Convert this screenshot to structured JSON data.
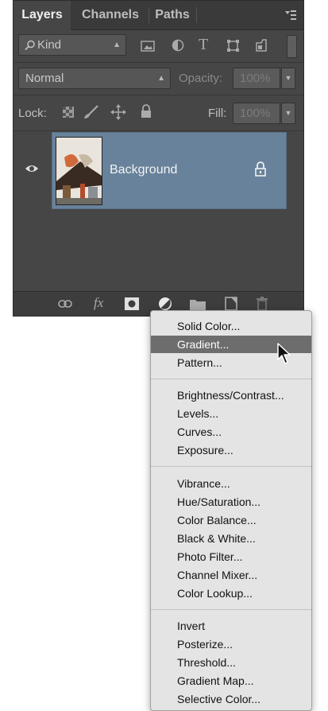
{
  "tabs": [
    {
      "label": "Layers",
      "active": true
    },
    {
      "label": "Channels",
      "active": false
    },
    {
      "label": "Paths",
      "active": false
    }
  ],
  "filter": {
    "kind_label": "Kind"
  },
  "blend": {
    "mode": "Normal",
    "opacity_label": "Opacity:",
    "opacity_value": "100%"
  },
  "lock": {
    "label": "Lock:",
    "fill_label": "Fill:",
    "fill_value": "100%"
  },
  "layer": {
    "name": "Background",
    "visible": true,
    "locked": true
  },
  "menu": {
    "groups": [
      [
        "Solid Color...",
        "Gradient...",
        "Pattern..."
      ],
      [
        "Brightness/Contrast...",
        "Levels...",
        "Curves...",
        "Exposure..."
      ],
      [
        "Vibrance...",
        "Hue/Saturation...",
        "Color Balance...",
        "Black & White...",
        "Photo Filter...",
        "Channel Mixer...",
        "Color Lookup..."
      ],
      [
        "Invert",
        "Posterize...",
        "Threshold...",
        "Gradient Map...",
        "Selective Color..."
      ]
    ],
    "highlighted": "Gradient..."
  },
  "colors": {
    "panel": "#464646",
    "selected_layer": "#68829b",
    "menu_bg": "#e4e4e4",
    "menu_highlight": "#6d6d6d"
  }
}
